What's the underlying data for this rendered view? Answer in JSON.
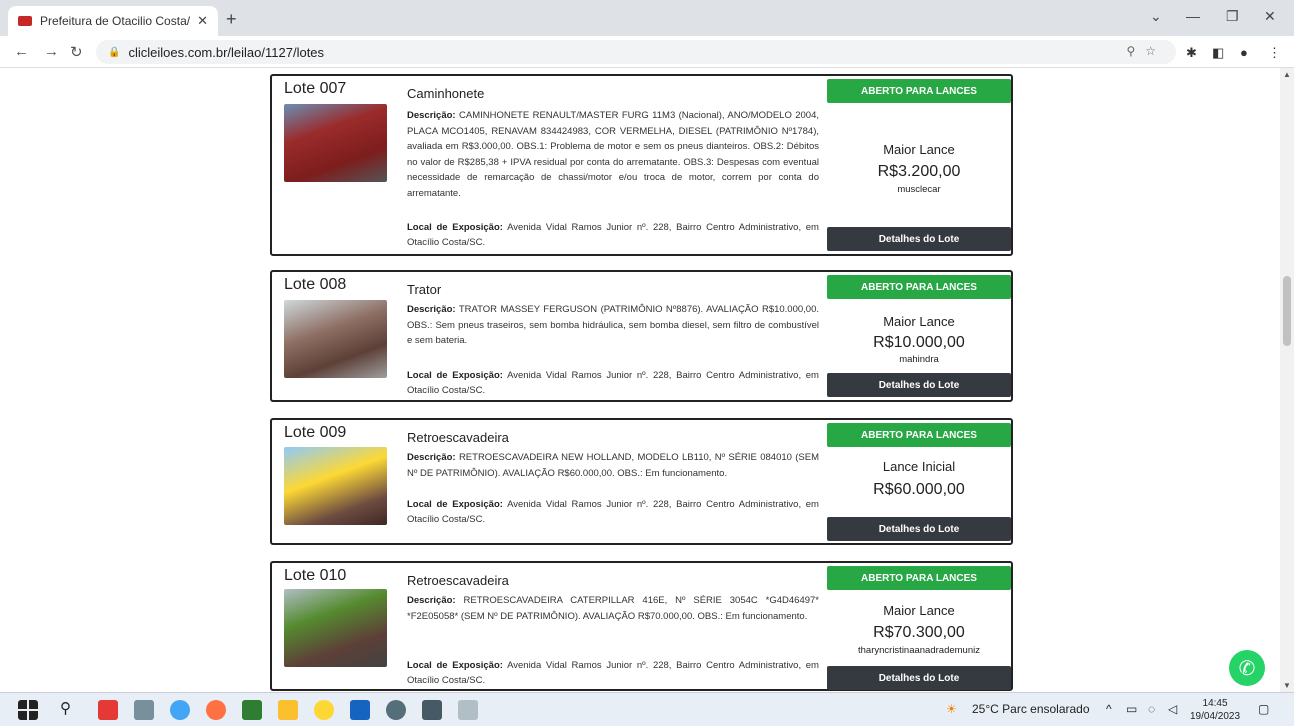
{
  "browser": {
    "tab_title": "Prefeitura de Otacilio Costa/SC :",
    "url": "clicleiloes.com.br/leilao/1127/lotes"
  },
  "lots": [
    {
      "number": "Lote 007",
      "name": "Caminhonete",
      "desc_label": "Descrição:",
      "description": "CAMINHONETE RENAULT/MASTER FURG 11M3 (Nacional), ANO/MODELO 2004, PLACA MCO1405, RENAVAM 834424983, COR VERMELHA, DIESEL (PATRIMÔNIO Nº1784), avaliada em R$3.000,00. OBS.1: Problema de motor e sem os pneus dianteiros. OBS.2: Débitos no valor de R$285,38 + IPVA residual por conta do arrematante. OBS.3: Despesas com eventual necessidade de remarcação de chassi/motor e/ou troca de motor, correm por conta do arrematante.",
      "loc_label": "Local de Exposição:",
      "location": "Avenida Vidal Ramos Junior nº. 228, Bairro Centro Administrativo, em Otacílio Costa/SC.",
      "status": "ABERTO PARA LANCES",
      "bid_label": "Maior Lance",
      "bid_value": "R$3.200,00",
      "bidder": "musclecar",
      "details": "Detalhes do Lote"
    },
    {
      "number": "Lote 008",
      "name": "Trator",
      "desc_label": "Descrição:",
      "description": "TRATOR MASSEY FERGUSON (PATRIMÔNIO Nº8876). AVALIAÇÃO R$10.000,00. OBS.: Sem pneus traseiros, sem bomba hidráulica, sem bomba diesel, sem filtro de combustível e sem bateria.",
      "loc_label": "Local de Exposição:",
      "location": "Avenida Vidal Ramos Junior nº. 228, Bairro Centro Administrativo, em Otacílio Costa/SC.",
      "status": "ABERTO PARA LANCES",
      "bid_label": "Maior Lance",
      "bid_value": "R$10.000,00",
      "bidder": "mahindra",
      "details": "Detalhes do Lote"
    },
    {
      "number": "Lote 009",
      "name": "Retroescavadeira",
      "desc_label": "Descrição:",
      "description": "RETROESCAVADEIRA NEW HOLLAND, MODELO LB110, Nº SÉRIE 084010 (SEM Nº DE PATRIMÔNIO). AVALIAÇÃO R$60.000,00. OBS.: Em funcionamento.",
      "loc_label": "Local de Exposição:",
      "location": "Avenida Vidal Ramos Junior nº. 228, Bairro Centro Administrativo, em Otacílio Costa/SC.",
      "status": "ABERTO PARA LANCES",
      "bid_label": "Lance Inicial",
      "bid_value": "R$60.000,00",
      "bidder": "",
      "details": "Detalhes do Lote"
    },
    {
      "number": "Lote 010",
      "name": "Retroescavadeira",
      "desc_label": "Descrição:",
      "description": "RETROESCAVADEIRA CATERPILLAR 416E, Nº SÉRIE 3054C *G4D46497* *F2E05058* (SEM Nº DE PATRIMÔNIO). AVALIAÇÃO R$70.000,00. OBS.: Em funcionamento.",
      "loc_label": "Local de Exposição:",
      "location": "Avenida Vidal Ramos Junior nº. 228, Bairro Centro Administrativo, em Otacílio Costa/SC.",
      "status": "ABERTO PARA LANCES",
      "bid_label": "Maior Lance",
      "bid_value": "R$70.300,00",
      "bidder": "tharyncristinaanadrademuniz",
      "details": "Detalhes do Lote"
    }
  ],
  "taskbar": {
    "weather": "25°C  Parc ensolarado",
    "time": "14:45",
    "date": "19/04/2023"
  },
  "colors": {
    "status_green": "#28a745",
    "details_dark": "#343a40",
    "whatsapp": "#25d366"
  }
}
